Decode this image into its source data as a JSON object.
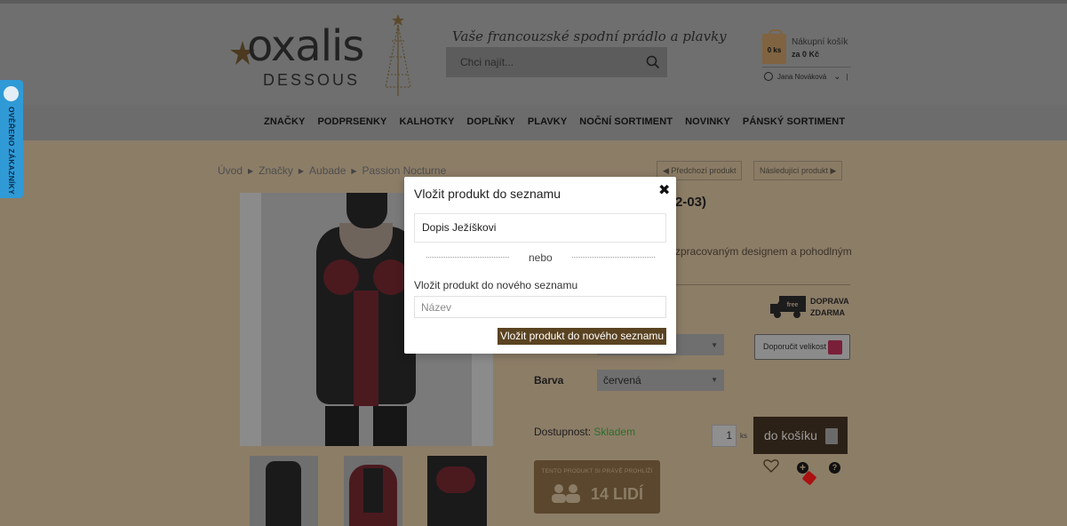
{
  "header": {
    "logo_word": "oxalis",
    "logo_sub": "DESSOUS",
    "slogan": "Vaše francouzské spodní prádlo a plavky",
    "search_placeholder": "Chci najít...",
    "cart": {
      "count": "0 ks",
      "label": "Nákupní košík",
      "total": "za 0 Kč"
    },
    "user": {
      "name": "Jana Nováková",
      "separator": "|"
    }
  },
  "nav": {
    "items": [
      "ZNAČKY",
      "PODPRSENKY",
      "KALHOTKY",
      "DOPLŇKY",
      "PLAVKY",
      "NOČNÍ SORTIMENT",
      "NOVINKY",
      "PÁNSKÝ SORTIMENT"
    ]
  },
  "side_tab": {
    "label": "OVĚŘENO ZÁKAZNÍKY"
  },
  "breadcrumb": [
    "Úvod",
    "Značky",
    "Aubade",
    "Passion Nocturne"
  ],
  "product_nav": {
    "prev": "Předchozí produkt",
    "next": "Následující produkt"
  },
  "product": {
    "title_fragment": "2-03)",
    "desc_fragment": "zpracovaným designem a pohodlným",
    "shipping": [
      "DOPRAVA",
      "ZDARMA"
    ],
    "truck_label": "free",
    "recommend_size": "Doporučit velikost",
    "color_label": "Barva",
    "color_value": "červená",
    "availability_label": "Dostupnost:",
    "availability_value": "Skladem",
    "quantity": "1",
    "quantity_unit": "ks",
    "add_to_cart": "do košíku",
    "viewers_text": "TENTO PRODUKT SI PRÁVĚ PROHLÍŽÍ",
    "viewers_count": "14 LIDÍ"
  },
  "modal": {
    "title": "Vložit produkt do seznamu",
    "close": "✖",
    "existing_list": "Dopis Ježíškovi",
    "or": "nebo",
    "new_list_label": "Vložit produkt do nového seznamu",
    "name_placeholder": "Název",
    "submit": "Vložit produkt do nového seznamu"
  },
  "colors": {
    "brand_brown": "#5a4321",
    "overlay": "#8c7d67",
    "verified_blue": "#2f9ad6"
  }
}
